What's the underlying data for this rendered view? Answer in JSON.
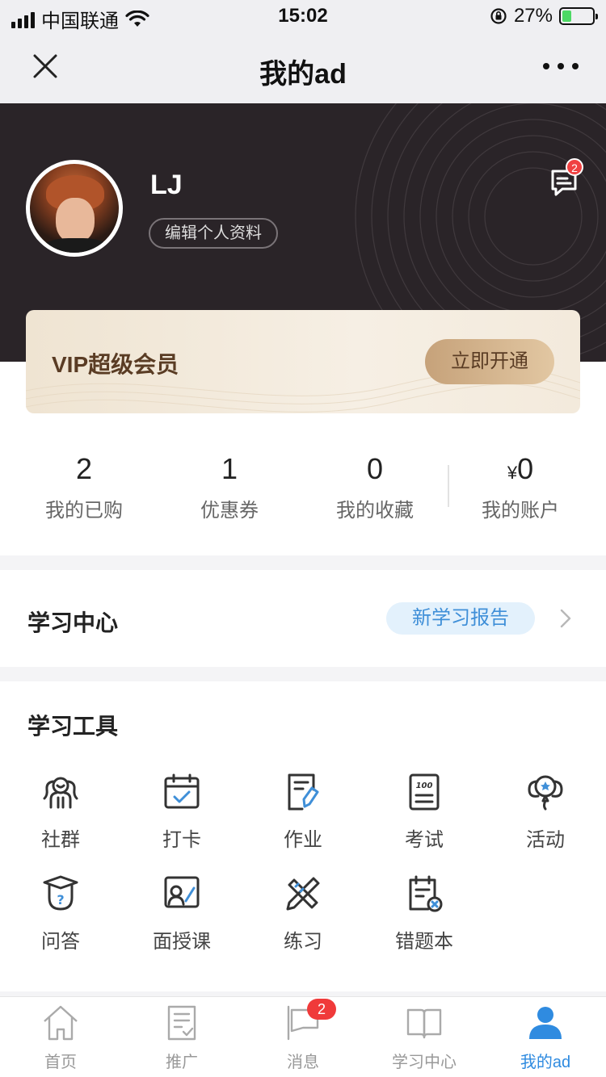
{
  "status_bar": {
    "carrier": "中国联通",
    "time": "15:02",
    "battery": "27%"
  },
  "nav": {
    "title": "我的ad"
  },
  "profile": {
    "username": "LJ",
    "edit_label": "编辑个人资料",
    "message_badge": "2"
  },
  "vip": {
    "title": "VIP超级会员",
    "button": "立即开通"
  },
  "stats": [
    {
      "value": "2",
      "label": "我的已购"
    },
    {
      "value": "1",
      "label": "优惠券"
    },
    {
      "value": "0",
      "label": "我的收藏"
    },
    {
      "currency": "¥",
      "value": "0",
      "label": "我的账户"
    }
  ],
  "learning_center": {
    "title": "学习中心",
    "report_label": "新学习报告"
  },
  "tools": {
    "title": "学习工具",
    "items": [
      {
        "label": "社群",
        "icon": "community-icon"
      },
      {
        "label": "打卡",
        "icon": "calendar-check-icon"
      },
      {
        "label": "作业",
        "icon": "homework-icon"
      },
      {
        "label": "考试",
        "icon": "exam-icon"
      },
      {
        "label": "活动",
        "icon": "balloon-icon"
      },
      {
        "label": "问答",
        "icon": "qa-icon"
      },
      {
        "label": "面授课",
        "icon": "face-class-icon"
      },
      {
        "label": "练习",
        "icon": "practice-icon"
      },
      {
        "label": "错题本",
        "icon": "wrong-notebook-icon"
      }
    ]
  },
  "tabbar": {
    "items": [
      {
        "label": "首页",
        "icon": "home-icon"
      },
      {
        "label": "推广",
        "icon": "promote-icon"
      },
      {
        "label": "消息",
        "icon": "message-flag-icon",
        "badge": "2"
      },
      {
        "label": "学习中心",
        "icon": "book-icon"
      },
      {
        "label": "我的ad",
        "icon": "user-icon",
        "active": true
      }
    ]
  },
  "colors": {
    "accent": "#2f8be0",
    "header_bg": "#2a2428",
    "vip_text": "#5a3c24",
    "badge": "#f03a3a"
  }
}
